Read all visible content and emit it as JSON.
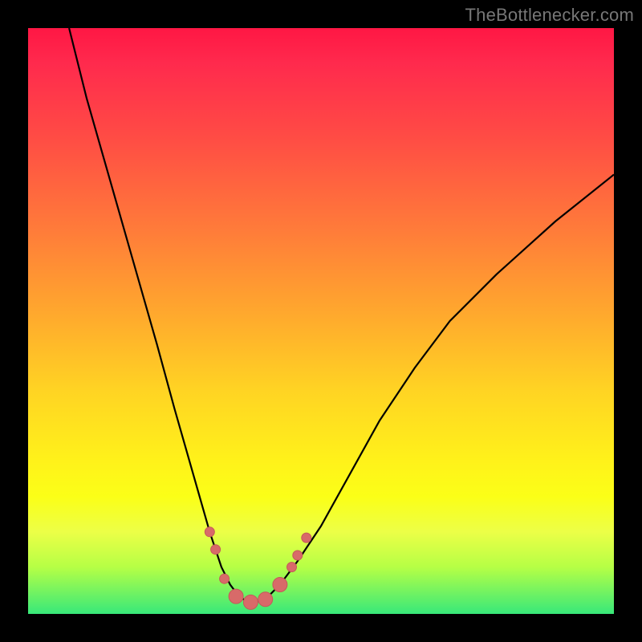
{
  "watermark": "TheBottleneсker.com",
  "colors": {
    "frame": "#000000",
    "gradient_top": "#ff1744",
    "gradient_bottom": "#38e87a",
    "curve": "#000000",
    "marker_fill": "#d86a69",
    "marker_stroke": "#c45a59"
  },
  "chart_data": {
    "type": "line",
    "title": "",
    "xlabel": "",
    "ylabel": "",
    "xlim": [
      0,
      100
    ],
    "ylim": [
      0,
      100
    ],
    "series": [
      {
        "name": "bottleneck-curve",
        "x": [
          7,
          10,
          14,
          18,
          22,
          25,
          27,
          29,
          31,
          33,
          34.5,
          36,
          37.5,
          39,
          41,
          43,
          46,
          50,
          55,
          60,
          66,
          72,
          80,
          90,
          100
        ],
        "y": [
          100,
          88,
          74,
          60,
          46,
          35,
          28,
          21,
          14,
          8,
          5,
          3,
          2,
          2,
          3,
          5,
          9,
          15,
          24,
          33,
          42,
          50,
          58,
          67,
          75
        ]
      }
    ],
    "markers": {
      "name": "highlight-points",
      "points": [
        {
          "x": 31.0,
          "y": 14.0,
          "r": 6
        },
        {
          "x": 32.0,
          "y": 11.0,
          "r": 6
        },
        {
          "x": 33.5,
          "y": 6.0,
          "r": 6
        },
        {
          "x": 35.5,
          "y": 3.0,
          "r": 9
        },
        {
          "x": 38.0,
          "y": 2.0,
          "r": 9
        },
        {
          "x": 40.5,
          "y": 2.5,
          "r": 9
        },
        {
          "x": 43.0,
          "y": 5.0,
          "r": 9
        },
        {
          "x": 45.0,
          "y": 8.0,
          "r": 6
        },
        {
          "x": 46.0,
          "y": 10.0,
          "r": 6
        },
        {
          "x": 47.5,
          "y": 13.0,
          "r": 6
        }
      ]
    }
  }
}
